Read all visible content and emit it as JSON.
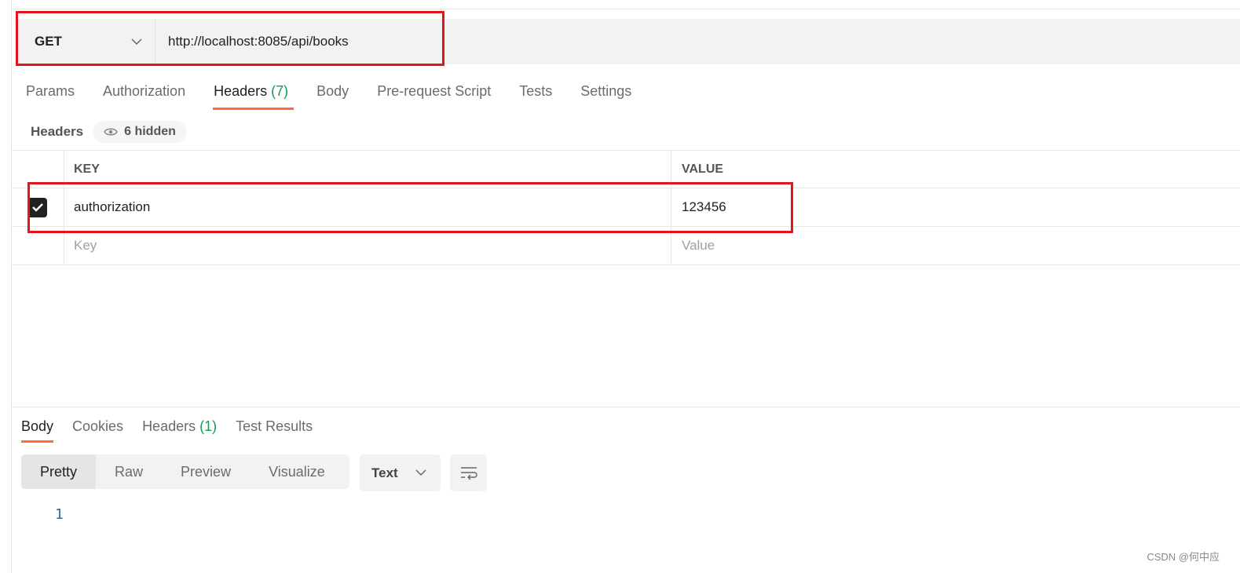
{
  "request": {
    "method": "GET",
    "url": "http://localhost:8085/api/books"
  },
  "tabs": [
    {
      "label": "Params"
    },
    {
      "label": "Authorization"
    },
    {
      "label": "Headers",
      "count": "(7)"
    },
    {
      "label": "Body"
    },
    {
      "label": "Pre-request Script"
    },
    {
      "label": "Tests"
    },
    {
      "label": "Settings"
    }
  ],
  "headers_section": {
    "title": "Headers",
    "hidden": "6 hidden"
  },
  "table": {
    "columns": [
      "KEY",
      "VALUE"
    ],
    "rows": [
      {
        "checked": true,
        "key": "authorization",
        "value": "123456"
      }
    ],
    "key_placeholder": "Key",
    "value_placeholder": "Value"
  },
  "response": {
    "tabs": [
      {
        "label": "Body"
      },
      {
        "label": "Cookies"
      },
      {
        "label": "Headers",
        "count": "(1)"
      },
      {
        "label": "Test Results"
      }
    ],
    "views": [
      "Pretty",
      "Raw",
      "Preview",
      "Visualize"
    ],
    "format": "Text",
    "line_numbers": [
      "1"
    ]
  },
  "watermark": "CSDN @何中应",
  "colors": {
    "accent": "#ff6c37",
    "highlight": "#e3141f",
    "count": "#0f9d58"
  }
}
